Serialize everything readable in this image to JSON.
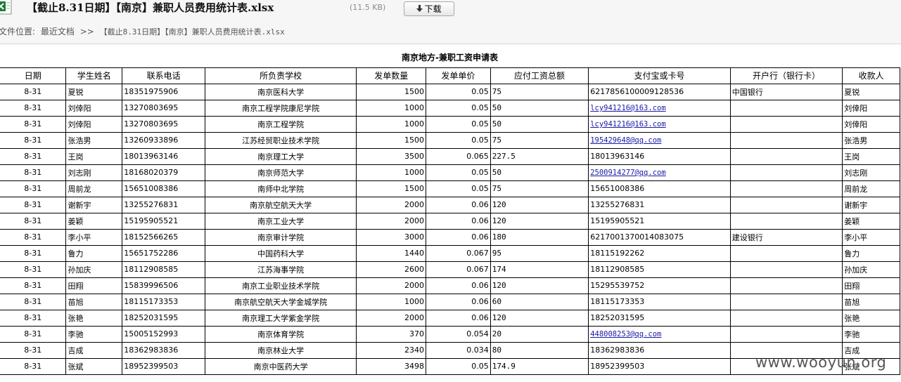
{
  "header": {
    "title": "【截止8.31日期】【南京】兼职人员费用统计表.xlsx",
    "size": "(11.5 KB)",
    "download_label": "下载",
    "file_icon": "excel-file-icon"
  },
  "breadcrumb": {
    "label": "文件位置:",
    "folder": "最近文档",
    "separator": ">>",
    "file": "【截止8.31日期】【南京】兼职人员费用统计表.xlsx"
  },
  "sheet": {
    "caption": "南京地方-兼职工资申请表",
    "columns": [
      "日期",
      "学生姓名",
      "联系电话",
      "所负责学校",
      "发单数量",
      "发单单价",
      "应付工资总额",
      "支付宝或卡号",
      "开户行（银行卡）",
      "收款人"
    ],
    "rows": [
      [
        "8-31",
        "夏锐",
        "18351975906",
        "南京医科大学",
        "1500",
        "0.05",
        "75",
        "6217856100009128536",
        "中国银行",
        "夏锐"
      ],
      [
        "8-31",
        "刘倖阳",
        "13270803695",
        "南京工程学院康尼学院",
        "1000",
        "0.05",
        "50",
        "lcy941216@163.com",
        "",
        "刘倖阳"
      ],
      [
        "8-31",
        "刘倖阳",
        "13270803695",
        "南京工程学院",
        "1000",
        "0.05",
        "50",
        "lcy941216@163.com",
        "",
        "刘倖阳"
      ],
      [
        "8-31",
        "张浩男",
        "13260933896",
        "江苏经贸职业技术学院",
        "1500",
        "0.05",
        "75",
        "195429648@qq.com",
        "",
        "张浩男"
      ],
      [
        "8-31",
        "王岗",
        "18013963146",
        "南京理工大学",
        "3500",
        "0.065",
        "227.5",
        "18013963146",
        "",
        "王岗"
      ],
      [
        "8-31",
        "刘志刚",
        "18168020379",
        "南京师范大学",
        "1000",
        "0.05",
        "50",
        "2500914277@qq.com",
        "",
        "刘志刚"
      ],
      [
        "8-31",
        "周前龙",
        "15651008386",
        "南师中北学院",
        "1500",
        "0.05",
        "75",
        "15651008386",
        "",
        "周前龙"
      ],
      [
        "8-31",
        "谢新宇",
        "13255276831",
        "南京航空航天大学",
        "2000",
        "0.06",
        "120",
        "13255276831",
        "",
        "谢新宇"
      ],
      [
        "8-31",
        "姜颖",
        "15195905521",
        "南京工业大学",
        "2000",
        "0.06",
        "120",
        "15195905521",
        "",
        "姜颖"
      ],
      [
        "8-31",
        "李小平",
        "18152566265",
        "南京审计学院",
        "3000",
        "0.06",
        "180",
        "6217001370014083075",
        "建设银行",
        "李小平"
      ],
      [
        "8-31",
        "鲁力",
        "15651752286",
        "中国药科大学",
        "1440",
        "0.067",
        "95",
        "18115192262",
        "",
        "鲁力"
      ],
      [
        "8-31",
        "孙加庆",
        "18112908585",
        "江苏海事学院",
        "2600",
        "0.067",
        "174",
        "18112908585",
        "",
        "孙加庆"
      ],
      [
        "8-31",
        "田翔",
        "15839996506",
        "南京工业职业技术学院",
        "2000",
        "0.06",
        "120",
        "15295539752",
        "",
        "田翔"
      ],
      [
        "8-31",
        "苗旭",
        "18115173353",
        "南京航空航天大学金城学院",
        "1000",
        "0.06",
        "60",
        "18115173353",
        "",
        "苗旭"
      ],
      [
        "8-31",
        "张艳",
        "18252031595",
        "南京理工大学紫金学院",
        "2000",
        "0.06",
        "120",
        "18252031595",
        "",
        "张艳"
      ],
      [
        "8-31",
        "李驰",
        "15005152993",
        "南京体育学院",
        "370",
        "0.054",
        "20",
        "448008253@qq.com",
        "",
        "李驰"
      ],
      [
        "8-31",
        "吉成",
        "18362983836",
        "南京林业大学",
        "2340",
        "0.034",
        "80",
        "18362983836",
        "",
        "吉成"
      ],
      [
        "8-31",
        "张斌",
        "18952399503",
        "南京中医药大学",
        "3498",
        "0.05",
        "174.9",
        "18952399503",
        "",
        "张斌"
      ]
    ],
    "linked_cells": [
      1,
      2,
      3,
      5,
      15
    ]
  },
  "watermark": "www.wooyun.org"
}
